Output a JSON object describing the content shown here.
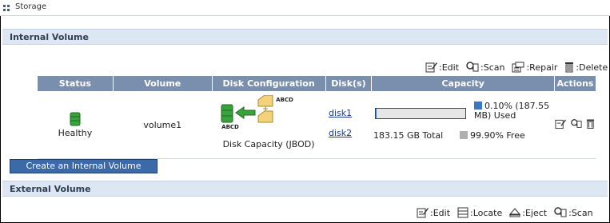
{
  "window": {
    "title": "Storage"
  },
  "internal": {
    "header": "Internal Volume",
    "toolbar": {
      "edit": ":Edit",
      "scan": ":Scan",
      "repair": ":Repair",
      "delete": ":Delete"
    },
    "columns": [
      "Status",
      "Volume",
      "Disk Configuration",
      "Disk(s)",
      "Capacity",
      "Actions"
    ],
    "row": {
      "status": "Healthy",
      "volume": "volume1",
      "disk_configuration": "Disk Capacity (JBOD)",
      "disk_icon_label": "ABCD",
      "disks": [
        "disk1",
        "disk2"
      ],
      "capacity": {
        "used_percent": 0.1,
        "used_text": "0.10% (187.55 MB) Used",
        "total_text": "183.15 GB Total",
        "free_text": "99.90% Free"
      }
    },
    "create_button": "Create an Internal Volume"
  },
  "external": {
    "header": "External Volume",
    "toolbar": {
      "edit": ":Edit",
      "locate": ":Locate",
      "eject": ":Eject",
      "scan": ":Scan"
    }
  },
  "colors": {
    "header_bg": "#dce7f3",
    "table_header": "#7a8fae",
    "used": "#3a78c3",
    "free": "#b0b0b0",
    "button": "#3c69a8"
  }
}
